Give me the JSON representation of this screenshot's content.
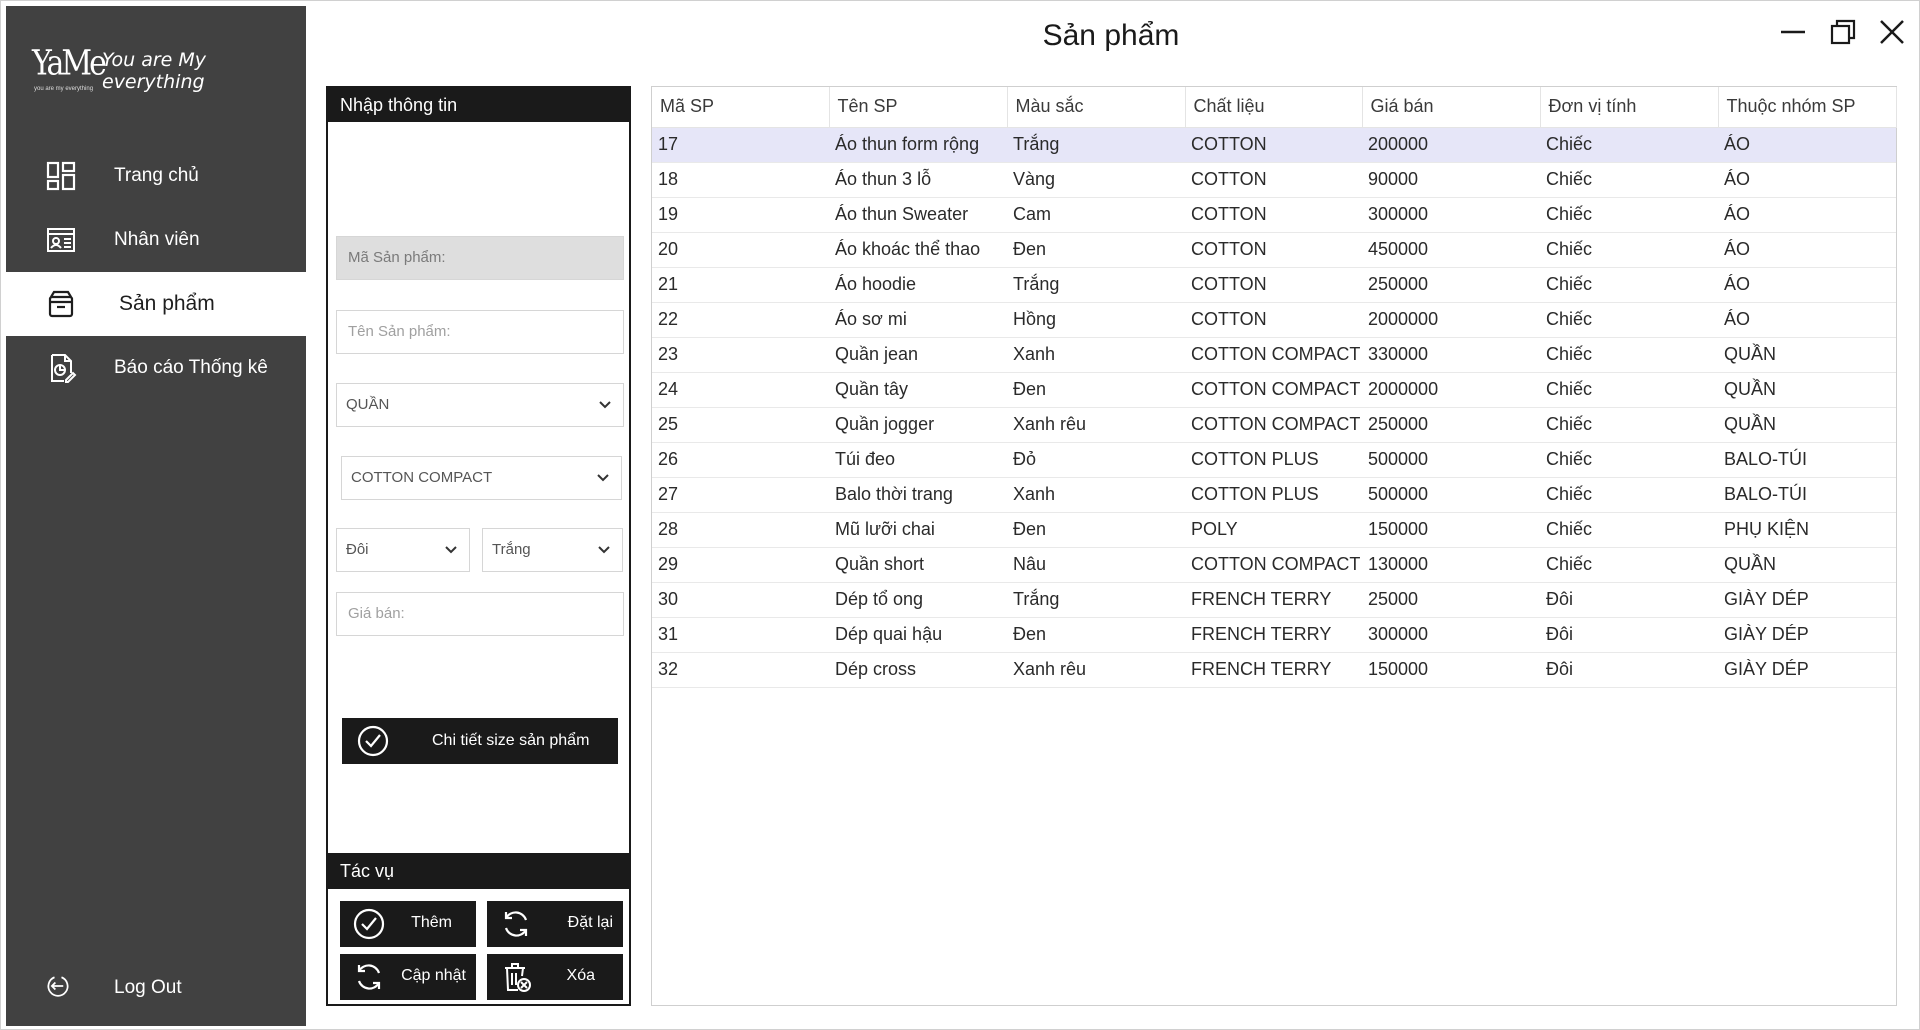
{
  "window": {
    "title": "Sản phẩm",
    "controls": [
      "minimize",
      "maximize",
      "close"
    ]
  },
  "sidebar": {
    "brand_logo": "YaMe",
    "brand_logo_small": "you are my everything",
    "brand_tagline": "You are My everything",
    "items": [
      {
        "label": "Trang chủ",
        "icon": "dashboard-icon",
        "active": false
      },
      {
        "label": "Nhân viên",
        "icon": "employee-card-icon",
        "active": false
      },
      {
        "label": "Sản phẩm",
        "icon": "box-icon",
        "active": true
      },
      {
        "label": "Báo cáo Thống kê",
        "icon": "report-icon",
        "active": false
      }
    ],
    "logout_label": "Log Out"
  },
  "input_panel": {
    "header": "Nhập thông tin",
    "ma_sp_placeholder": "Mã Sản phẩm:",
    "ten_sp_placeholder": "Tên Sản phẩm:",
    "nhom_select": "QUẦN",
    "chat_lieu_select": "COTTON COMPACT",
    "don_vi_select": "Đôi",
    "mau_sac_select": "Trắng",
    "gia_ban_placeholder": "Giá bán:",
    "detail_button": "Chi tiết size sản phẩm"
  },
  "tasks": {
    "header": "Tác vụ",
    "add": "Thêm",
    "reset": "Đặt lại",
    "update": "Cập nhật",
    "delete": "Xóa"
  },
  "table": {
    "columns": [
      "Mã SP",
      "Tên SP",
      "Màu sắc",
      "Chất liệu",
      "Giá bán",
      "Đơn vị tính",
      "Thuộc nhóm SP"
    ],
    "rows": [
      [
        "17",
        "Áo thun form rộng",
        "Trắng",
        "COTTON",
        "200000",
        "Chiếc",
        "ÁO"
      ],
      [
        "18",
        "Áo thun 3 lỗ",
        "Vàng",
        "COTTON",
        "90000",
        "Chiếc",
        "ÁO"
      ],
      [
        "19",
        "Áo thun Sweater",
        "Cam",
        "COTTON",
        "300000",
        "Chiếc",
        "ÁO"
      ],
      [
        "20",
        "Áo khoác thể thao",
        "Đen",
        "COTTON",
        "450000",
        "Chiếc",
        "ÁO"
      ],
      [
        "21",
        "Áo hoodie",
        "Trắng",
        "COTTON",
        "250000",
        "Chiếc",
        "ÁO"
      ],
      [
        "22",
        "Áo sơ mi",
        "Hồng",
        "COTTON",
        "2000000",
        "Chiếc",
        "ÁO"
      ],
      [
        "23",
        "Quần jean",
        "Xanh",
        "COTTON COMPACT",
        "330000",
        "Chiếc",
        "QUẦN"
      ],
      [
        "24",
        "Quần tây",
        "Đen",
        "COTTON COMPACT",
        "2000000",
        "Chiếc",
        "QUẦN"
      ],
      [
        "25",
        "Quần jogger",
        "Xanh rêu",
        "COTTON COMPACT",
        "250000",
        "Chiếc",
        "QUẦN"
      ],
      [
        "26",
        "Túi đeo",
        "Đỏ",
        "COTTON PLUS",
        "500000",
        "Chiếc",
        "BALO-TÚI"
      ],
      [
        "27",
        "Balo thời trang",
        "Xanh",
        "COTTON PLUS",
        "500000",
        "Chiếc",
        "BALO-TÚI"
      ],
      [
        "28",
        "Mũ lưỡi chai",
        "Đen",
        "POLY",
        "150000",
        "Chiếc",
        "PHỤ KIỆN"
      ],
      [
        "29",
        "Quần short",
        "Nâu",
        "COTTON COMPACT",
        "130000",
        "Chiếc",
        "QUẦN"
      ],
      [
        "30",
        "Dép tổ ong",
        "Trắng",
        "FRENCH TERRY",
        "25000",
        "Đôi",
        "GIÀY DÉP"
      ],
      [
        "31",
        "Dép quai hậu",
        "Đen",
        "FRENCH TERRY",
        "300000",
        "Đôi",
        "GIÀY DÉP"
      ],
      [
        "32",
        "Dép cross",
        "Xanh rêu",
        "FRENCH TERRY",
        "150000",
        "Đôi",
        "GIÀY DÉP"
      ]
    ],
    "selected_row": 0
  },
  "colors": {
    "sidebar_bg": "#414141",
    "dark": "#1a1a1a",
    "row_selected": "#e6e6f8"
  }
}
